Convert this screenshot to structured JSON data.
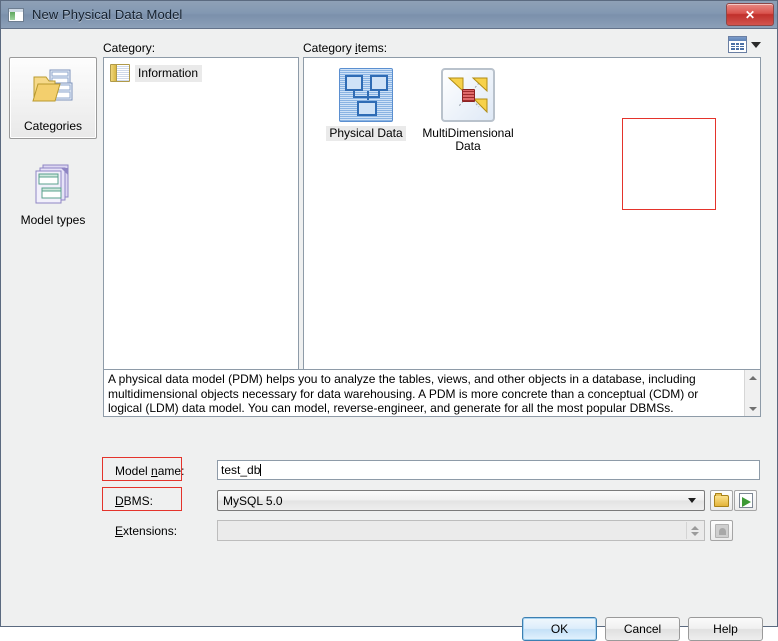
{
  "window": {
    "title": "New Physical Data Model",
    "icon": "window-model-icon",
    "close_label": "✕"
  },
  "toolbar": {
    "view_mode_icon": "grid-view-icon",
    "view_mode_caret": "chevron-down-icon"
  },
  "labels": {
    "category": "Category:",
    "category_items": "Category items:"
  },
  "rail": {
    "items": [
      {
        "label": "Categories",
        "icon": "folder-pages-icon",
        "selected": true
      },
      {
        "label": "Model types",
        "icon": "stacked-windows-icon",
        "selected": false
      }
    ]
  },
  "category_list": {
    "items": [
      {
        "label": "Information",
        "icon": "information-book-icon",
        "selected": true
      }
    ]
  },
  "category_items": {
    "items": [
      {
        "label": "Physical Data",
        "icon": "physical-data-icon",
        "selected": true
      },
      {
        "label": "MultiDimensional Data",
        "label_line1": "MultiDimensional",
        "label_line2": "Data",
        "icon": "multidimensional-data-icon",
        "selected": false
      }
    ]
  },
  "description": {
    "text": "A physical data model (PDM) helps you to analyze the tables, views, and other objects in a database, including multidimensional objects necessary for data warehousing. A PDM is more concrete than a conceptual (CDM) or logical (LDM) data model. You can model, reverse-engineer, and generate for all the most popular DBMSs.",
    "scroll_up_icon": "scroll-up-arrow-icon",
    "scroll_down_icon": "scroll-down-arrow-icon"
  },
  "form": {
    "model_name": {
      "label_pre": "Model ",
      "label_accel": "n",
      "label_post": "ame:",
      "value": "test_db",
      "placeholder": ""
    },
    "dbms": {
      "label_accel": "D",
      "label_post": "BMS:",
      "value": "MySQL 5.0",
      "dropdown_icon": "chevron-down-icon",
      "browse_icon": "folder-icon",
      "new_icon": "new-document-icon"
    },
    "extensions": {
      "label_accel": "E",
      "label_post": "xtensions:",
      "value": "",
      "spinner_icon": "spinner-icon",
      "button_icon": "extensions-icon"
    }
  },
  "footer": {
    "ok": "OK",
    "cancel": "Cancel",
    "help": "Help"
  },
  "colors": {
    "titlebar": "#8298b2",
    "dialog_bg": "#eff0f0",
    "annotation_red": "#e4332b",
    "default_button_border": "#3c7fb1"
  }
}
